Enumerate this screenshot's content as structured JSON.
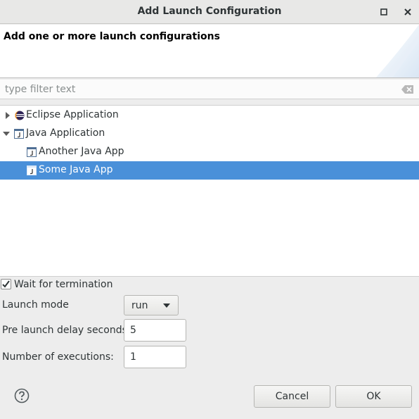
{
  "window": {
    "title": "Add Launch Configuration"
  },
  "banner": {
    "heading": "Add one or more launch configurations"
  },
  "filter": {
    "placeholder": "type filter text",
    "value": ""
  },
  "tree": {
    "items": [
      {
        "label": "Eclipse Application",
        "expanded": false,
        "icon": "eclipse-icon"
      },
      {
        "label": "Java Application",
        "expanded": true,
        "icon": "java-app-icon"
      },
      {
        "label": "Another Java App",
        "icon": "java-app-icon"
      },
      {
        "label": "Some Java App",
        "icon": "java-app-icon",
        "selected": true
      }
    ]
  },
  "options": {
    "wait_label": "Wait for termination",
    "wait_checked": true,
    "launch_mode_label": "Launch mode",
    "launch_mode_value": "run",
    "delay_label": "Pre launch delay seconds:",
    "delay_value": "5",
    "executions_label": "Number of executions:",
    "executions_value": "1"
  },
  "buttons": {
    "cancel": "Cancel",
    "ok": "OK"
  },
  "colors": {
    "selection": "#4a90d9",
    "background": "#ededed"
  }
}
